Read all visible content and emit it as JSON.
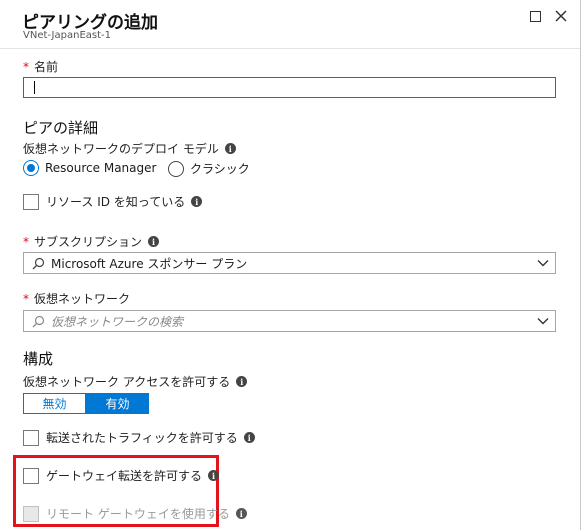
{
  "header": {
    "title": "ピアリングの追加",
    "subtitle": "VNet-JapanEast-1"
  },
  "name_field": {
    "label": "名前",
    "value": "",
    "required_mark": "*"
  },
  "peer_details": {
    "heading": "ピアの詳細",
    "deploy_model_label": "仮想ネットワークのデプロイ モデル",
    "options": [
      "Resource Manager",
      "クラシック"
    ],
    "selected": "Resource Manager",
    "know_resource_id_label": "リソース ID を知っている"
  },
  "subscription": {
    "label": "サブスクリプション",
    "value": "Microsoft Azure スポンサー プラン"
  },
  "vnet": {
    "label": "仮想ネットワーク",
    "placeholder": "仮想ネットワークの検索"
  },
  "config": {
    "heading": "構成",
    "access_label": "仮想ネットワーク アクセスを許可する",
    "toggle_off": "無効",
    "toggle_on": "有効",
    "toggle_value": "有効",
    "forwarded_traffic_label": "転送されたトラフィックを許可する",
    "gateway_transit_label": "ゲートウェイ転送を許可する",
    "remote_gateway_label": "リモート ゲートウェイを使用する"
  },
  "colors": {
    "accent": "#0078d4",
    "required": "#e00b1c",
    "highlight": "#e4121b"
  },
  "icons": {
    "info": "info-icon",
    "search": "search-icon",
    "chevron": "chevron-down-icon",
    "maximize": "maximize-icon",
    "close": "close-icon"
  }
}
